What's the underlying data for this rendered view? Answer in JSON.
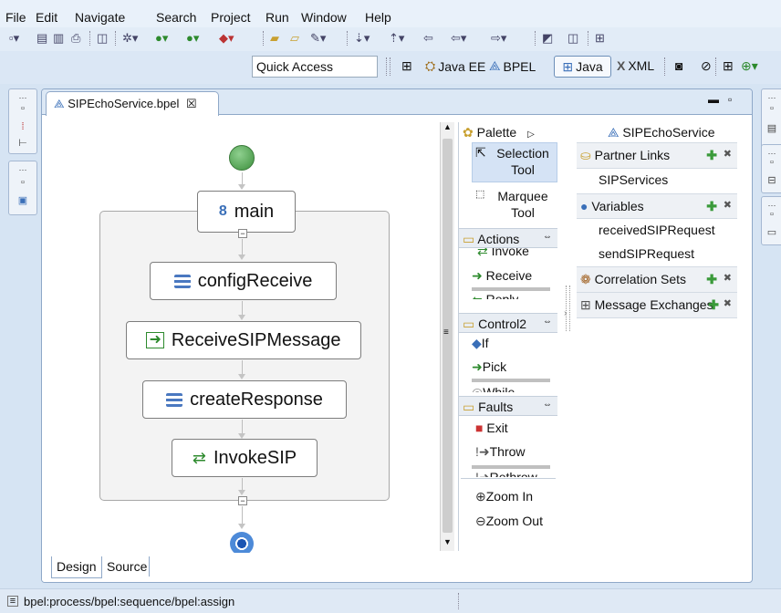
{
  "menu": [
    "File",
    "Edit",
    "Navigate",
    "Search",
    "Project",
    "Run",
    "Window",
    "Help"
  ],
  "quick_access": {
    "placeholder": "Quick Access"
  },
  "perspectives": [
    "Java EE",
    "BPEL",
    "Java",
    "XML"
  ],
  "editor": {
    "tab_title": "SIPEchoService.bpel",
    "tab_close": "☒"
  },
  "diagram": {
    "main_label": "main",
    "activities": [
      "configReceive",
      "ReceiveSIPMessage",
      "createResponse",
      "InvokeSIP"
    ]
  },
  "palette": {
    "title": "Palette",
    "tools": [
      "Selection Tool",
      "Marquee Tool"
    ],
    "categories": [
      {
        "name": "Actions",
        "items": [
          "Invoke",
          "Receive",
          "Reply"
        ]
      },
      {
        "name": "Control2",
        "items": [
          "If",
          "Pick",
          "While"
        ]
      },
      {
        "name": "Faults",
        "items": [
          "Exit",
          "Throw",
          "Rethrow"
        ]
      }
    ],
    "zoom_in": "Zoom In",
    "zoom_out": "Zoom Out"
  },
  "outline": {
    "process": "SIPEchoService",
    "partner_links": {
      "label": "Partner Links",
      "items": [
        "SIPServices"
      ]
    },
    "variables": {
      "label": "Variables",
      "items": [
        "receivedSIPRequest",
        "sendSIPRequest"
      ]
    },
    "correlation_sets": "Correlation Sets",
    "message_exchanges": "Message Exchanges"
  },
  "bottom_tabs": [
    "Design",
    "Source"
  ],
  "status": {
    "path": "bpel:process/bpel:sequence/bpel:assign"
  }
}
